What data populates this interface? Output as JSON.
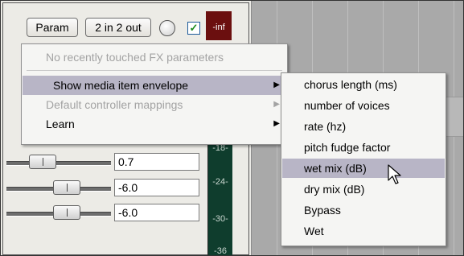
{
  "toolbar": {
    "param_label": "Param",
    "io_label": "2 in 2 out",
    "bypass_checked": "✓",
    "meter_value": "-inf"
  },
  "sliders": [
    {
      "value": "0.7"
    },
    {
      "value": "-6.0"
    },
    {
      "value": "-6.0"
    }
  ],
  "meter_scale": [
    "-18-",
    "-24-",
    "-30-",
    "-36"
  ],
  "context_menu": {
    "items": [
      {
        "label": "No recently touched FX parameters",
        "enabled": false
      },
      {
        "label": "Show media item envelope",
        "enabled": true,
        "submenu": true,
        "highlighted": true
      },
      {
        "label": "Default controller mappings",
        "enabled": false,
        "submenu": true
      },
      {
        "label": "Learn",
        "enabled": true,
        "submenu": true
      }
    ]
  },
  "submenu": {
    "items": [
      {
        "label": "chorus length (ms)"
      },
      {
        "label": "number of voices"
      },
      {
        "label": "rate (hz)"
      },
      {
        "label": "pitch fudge factor"
      },
      {
        "label": "wet mix (dB)",
        "highlighted": true
      },
      {
        "label": "dry mix (dB)"
      },
      {
        "label": "Bypass"
      },
      {
        "label": "Wet"
      }
    ]
  },
  "icons": {
    "submenu_arrow": "▶",
    "cursor": "mouse-pointer-icon"
  },
  "colors": {
    "menu_highlight": "#b8b5c6",
    "meter_bg": "#6b0f0f",
    "vmeter_bg": "#0f3d2d",
    "check_color": "#1a8a1a"
  }
}
